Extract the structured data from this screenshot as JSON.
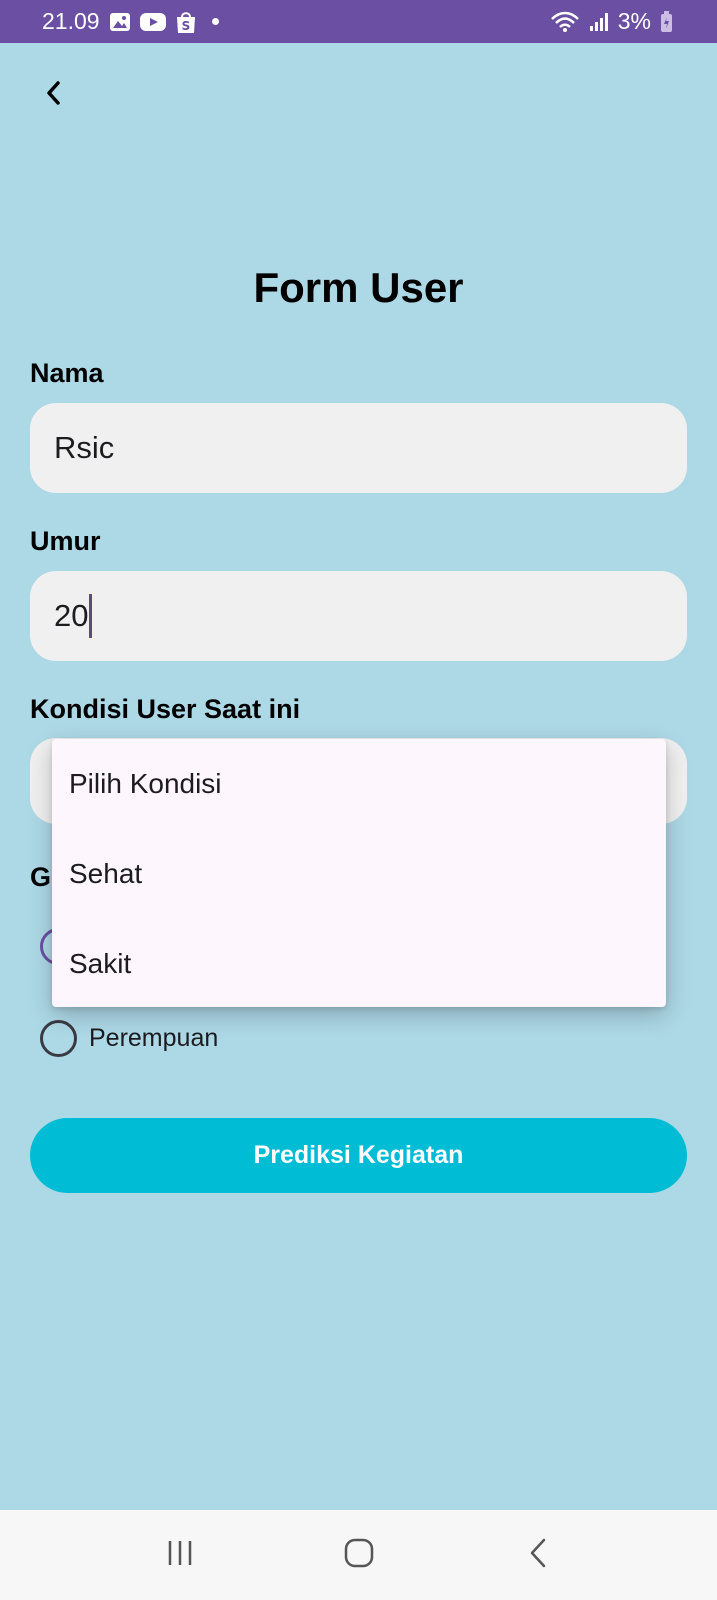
{
  "status_bar": {
    "time": "21.09",
    "battery": "3%",
    "icons": [
      "gallery-icon",
      "youtube-icon",
      "shopee-icon",
      "notification-dot-icon",
      "wifi-icon",
      "signal-icon",
      "battery-charging-icon"
    ]
  },
  "header": {
    "back_icon": "chevron-left-icon"
  },
  "page": {
    "title": "Form User"
  },
  "form": {
    "name_label": "Nama",
    "name_value": "Rsic",
    "age_label": "Umur",
    "age_value": "20",
    "condition_label": "Kondisi User Saat ini",
    "gender_label_visible": "G",
    "gender_options": [
      "",
      "Perempuan"
    ],
    "submit_label": "Prediksi Kegiatan"
  },
  "dropdown": {
    "items": [
      "Pilih Kondisi",
      "Sehat",
      "Sakit"
    ]
  },
  "nav_bar": {
    "icons": [
      "recent-apps-icon",
      "home-icon",
      "back-icon"
    ]
  },
  "colors": {
    "status_bar": "#6a4fa3",
    "background": "#add8e6",
    "button": "#00bcd4",
    "field": "#f0f0f0",
    "menu": "#fdf7fd"
  }
}
